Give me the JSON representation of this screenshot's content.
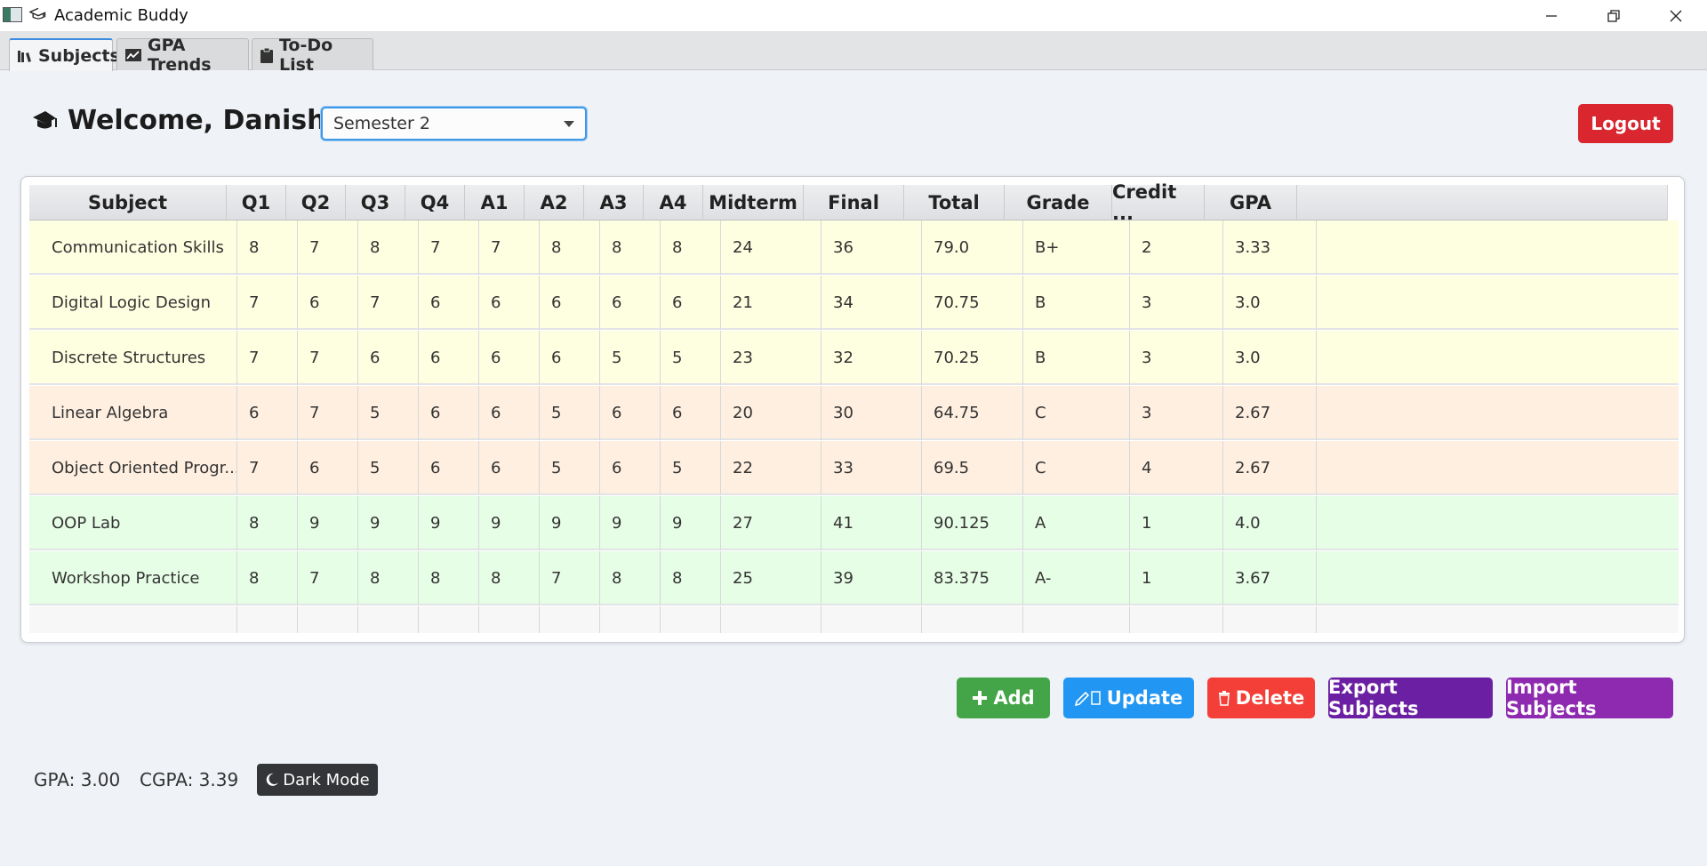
{
  "window": {
    "title": "Academic Buddy"
  },
  "tabs": [
    {
      "label": "Subjects",
      "icon": "books-icon",
      "active": true
    },
    {
      "label": "GPA Trends",
      "icon": "chart-icon",
      "active": false
    },
    {
      "label": "To-Do List",
      "icon": "clipboard-icon",
      "active": false
    }
  ],
  "header": {
    "welcome": "Welcome, Danish!",
    "semester": "Semester 2",
    "logout": "Logout"
  },
  "table": {
    "columns": [
      "Subject",
      "Q1",
      "Q2",
      "Q3",
      "Q4",
      "A1",
      "A2",
      "A3",
      "A4",
      "Midterm",
      "Final",
      "Total",
      "Grade",
      "Credit ...",
      "GPA"
    ],
    "rows": [
      {
        "cells": [
          "Communication Skills",
          "8",
          "7",
          "8",
          "7",
          "7",
          "8",
          "8",
          "8",
          "24",
          "36",
          "79.0",
          "B+",
          "2",
          "3.33"
        ],
        "color": "#fefee0"
      },
      {
        "cells": [
          "Digital Logic Design",
          "7",
          "6",
          "7",
          "6",
          "6",
          "6",
          "6",
          "6",
          "21",
          "34",
          "70.75",
          "B",
          "3",
          "3.0"
        ],
        "color": "#fefee0"
      },
      {
        "cells": [
          "Discrete Structures",
          "7",
          "7",
          "6",
          "6",
          "6",
          "6",
          "5",
          "5",
          "23",
          "32",
          "70.25",
          "B",
          "3",
          "3.0"
        ],
        "color": "#fefee0"
      },
      {
        "cells": [
          "Linear Algebra",
          "6",
          "7",
          "5",
          "6",
          "6",
          "5",
          "6",
          "6",
          "20",
          "30",
          "64.75",
          "C",
          "3",
          "2.67"
        ],
        "color": "#feefe0"
      },
      {
        "cells": [
          "Object Oriented Progr...",
          "7",
          "6",
          "5",
          "6",
          "6",
          "5",
          "6",
          "5",
          "22",
          "33",
          "69.5",
          "C",
          "4",
          "2.67"
        ],
        "color": "#feefe0"
      },
      {
        "cells": [
          "OOP Lab",
          "8",
          "9",
          "9",
          "9",
          "9",
          "9",
          "9",
          "9",
          "27",
          "41",
          "90.125",
          "A",
          "1",
          "4.0"
        ],
        "color": "#e6fde6"
      },
      {
        "cells": [
          "Workshop Practice",
          "8",
          "7",
          "8",
          "8",
          "8",
          "7",
          "8",
          "8",
          "25",
          "39",
          "83.375",
          "A-",
          "1",
          "3.67"
        ],
        "color": "#e6fde6"
      }
    ]
  },
  "actions": {
    "add": "Add",
    "update": "Update",
    "delete": "Delete",
    "export": "Export Subjects",
    "import": "Import Subjects"
  },
  "footer": {
    "gpa": "GPA: 3.00",
    "cgpa": "CGPA: 3.39",
    "dark_mode": "Dark Mode"
  }
}
